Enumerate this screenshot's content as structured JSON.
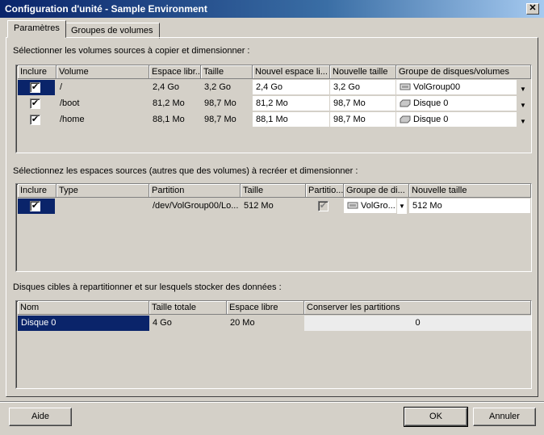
{
  "window": {
    "title": "Configuration d'unité - Sample Environment",
    "close": "✕"
  },
  "tabs": [
    {
      "label": "Paramètres"
    },
    {
      "label": "Groupes de volumes"
    }
  ],
  "section1": {
    "label": "Sélectionner les volumes sources à copier et dimensionner :",
    "headers": [
      "Inclure",
      "Volume",
      "Espace libr...",
      "Taille",
      "Nouvel espace li...",
      "Nouvelle taille",
      "Groupe de disques/volumes"
    ],
    "rows": [
      {
        "volume": "/",
        "free": "2,4 Go",
        "size": "3,2 Go",
        "new_free": "2,4 Go",
        "new_size": "3,2 Go",
        "group": "VolGroup00"
      },
      {
        "volume": "/boot",
        "free": "81,2 Mo",
        "size": "98,7 Mo",
        "new_free": "81,2 Mo",
        "new_size": "98,7 Mo",
        "group": "Disque 0"
      },
      {
        "volume": "/home",
        "free": "88,1 Mo",
        "size": "98,7 Mo",
        "new_free": "88,1 Mo",
        "new_size": "98,7 Mo",
        "group": "Disque 0"
      }
    ]
  },
  "section2": {
    "label": "Sélectionnez les espaces sources (autres que des volumes) à recréer et dimensionner :",
    "headers": [
      "Inclure",
      "Type",
      "Partition",
      "Taille",
      "Partitio...",
      "Groupe de di...",
      "Nouvelle taille"
    ],
    "rows": [
      {
        "type": "",
        "partition": "/dev/VolGroup00/Lo...",
        "size": "512 Mo",
        "group": "VolGro...",
        "new_size": "512 Mo"
      }
    ]
  },
  "section3": {
    "label": "Disques cibles à repartitionner et sur lesquels stocker des données :",
    "headers": [
      "Nom",
      "Taille totale",
      "Espace libre",
      "Conserver les partitions"
    ],
    "rows": [
      {
        "name": "Disque 0",
        "total": "4 Go",
        "free": "20 Mo",
        "keep": "0"
      }
    ]
  },
  "buttons": {
    "help": "Aide",
    "ok": "OK",
    "cancel": "Annuler"
  },
  "check_glyph": "✔"
}
